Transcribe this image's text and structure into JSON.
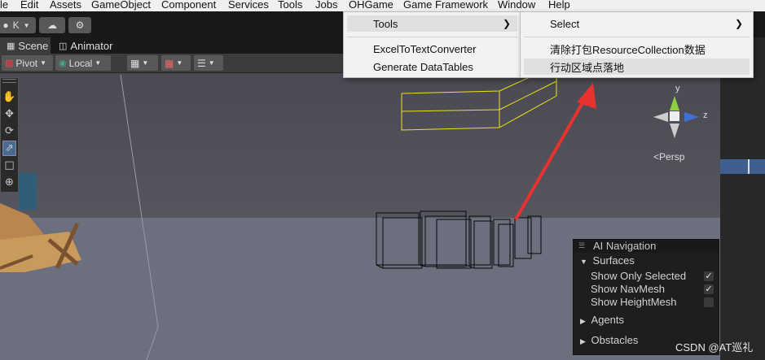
{
  "menubar": {
    "items": [
      {
        "label": "le"
      },
      {
        "label": "Edit"
      },
      {
        "label": "Assets"
      },
      {
        "label": "GameObject"
      },
      {
        "label": "Component"
      },
      {
        "label": "Services"
      },
      {
        "label": "Tools"
      },
      {
        "label": "Jobs"
      },
      {
        "label": "OHGame"
      },
      {
        "label": "Game Framework"
      },
      {
        "label": "Window"
      },
      {
        "label": "Help"
      }
    ]
  },
  "toolbar": {
    "account_label": "K"
  },
  "tabs": [
    {
      "label": "Scene",
      "icon": "grid-icon"
    },
    {
      "label": "Animator",
      "icon": "animator-icon"
    }
  ],
  "scene_toolbar": {
    "pivot_label": "Pivot",
    "local_label": "Local"
  },
  "ohgame_menu": {
    "items": [
      {
        "label": "Tools",
        "has_submenu": true
      },
      {
        "label": "ExcelToTextConverter"
      },
      {
        "label": "Generate DataTables"
      }
    ]
  },
  "tools_submenu": {
    "items": [
      {
        "label": "Select",
        "has_submenu": true
      },
      {
        "label": "清除打包ResourceCollection数据"
      },
      {
        "label": "行动区域点落地"
      }
    ]
  },
  "gizmo": {
    "y_label": "y",
    "z_label": "z",
    "persp_label": "Persp"
  },
  "ai_navigation": {
    "title": "AI Navigation",
    "surfaces_label": "Surfaces",
    "options": [
      {
        "label": "Show Only Selected",
        "checked": true
      },
      {
        "label": "Show NavMesh",
        "checked": true
      },
      {
        "label": "Show HeightMesh",
        "checked": false
      }
    ],
    "agents_label": "Agents",
    "obstacles_label": "Obstacles"
  },
  "watermark": "CSDN @AT巡礼",
  "colors": {
    "arrow": "#e8322f",
    "wireframe_yellow": "#f0e020",
    "menu_bg": "#f2f2f2"
  }
}
